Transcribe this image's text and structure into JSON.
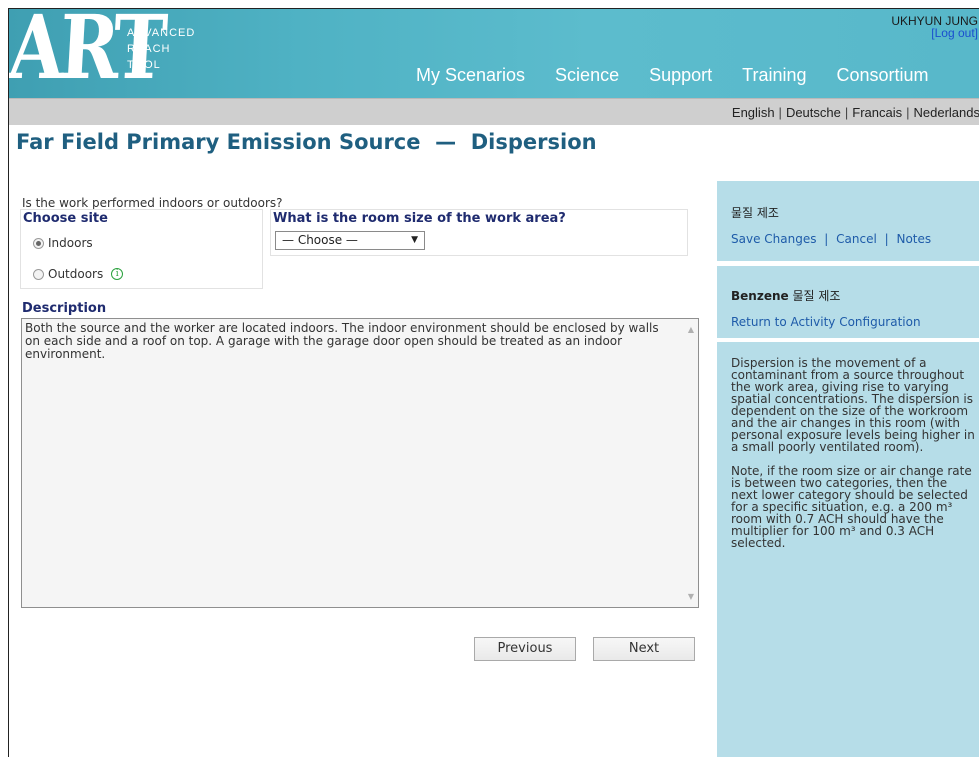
{
  "header": {
    "logo_text": "ART",
    "logo_lines": [
      "ADVANCED",
      "REACH",
      "TOOL"
    ],
    "user_name": "UKHYUN JUNG",
    "logout_label": "[Log out]",
    "nav": [
      "My Scenarios",
      "Science",
      "Support",
      "Training",
      "Consortium"
    ]
  },
  "languages": [
    "English",
    "Deutsche",
    "Francais",
    "Nederlands"
  ],
  "page_title": "Far Field Primary Emission Source  —  Dispersion",
  "form": {
    "question": "Is the work performed indoors or outdoors?",
    "site_label": "Choose site",
    "options": [
      {
        "label": "Indoors",
        "selected": true
      },
      {
        "label": "Outdoors",
        "selected": false
      }
    ],
    "room_label": "What is the room size of the work area?",
    "room_select_value": "— Choose —",
    "description_label": "Description",
    "description_text": "Both the source and the worker are located indoors. The indoor environment should be enclosed by walls on each side and a roof on top. A garage with the garage door open should be treated as an indoor environment."
  },
  "buttons": {
    "previous": "Previous",
    "next": "Next"
  },
  "sidebar": {
    "scenario_title": "물질 제조",
    "actions": [
      "Save Changes",
      "Cancel",
      "Notes"
    ],
    "substance_bold": "Benzene",
    "substance_rest": " 물질 제조",
    "return_link": "Return to Activity Configuration",
    "help_paragraphs": [
      "Dispersion is the movement of a contaminant from a source throughout the work area, giving rise to varying spatial concentrations. The dispersion is dependent on the size of the workroom and the air changes in this room (with personal exposure levels being higher in a small poorly ventilated room).",
      "Note, if the room size or air change rate is between two categories, then the next lower category should be selected for a specific situation, e.g. a 200 m³ room with 0.7 ACH should have the multiplier for 100 m³ and 0.3 ACH selected."
    ]
  },
  "colors": {
    "header_bg": "#4fb2c4",
    "title": "#1f5f80",
    "label": "#1f2b6f",
    "sidebar_bg": "#b6dde8",
    "link": "#1e5ba9"
  }
}
